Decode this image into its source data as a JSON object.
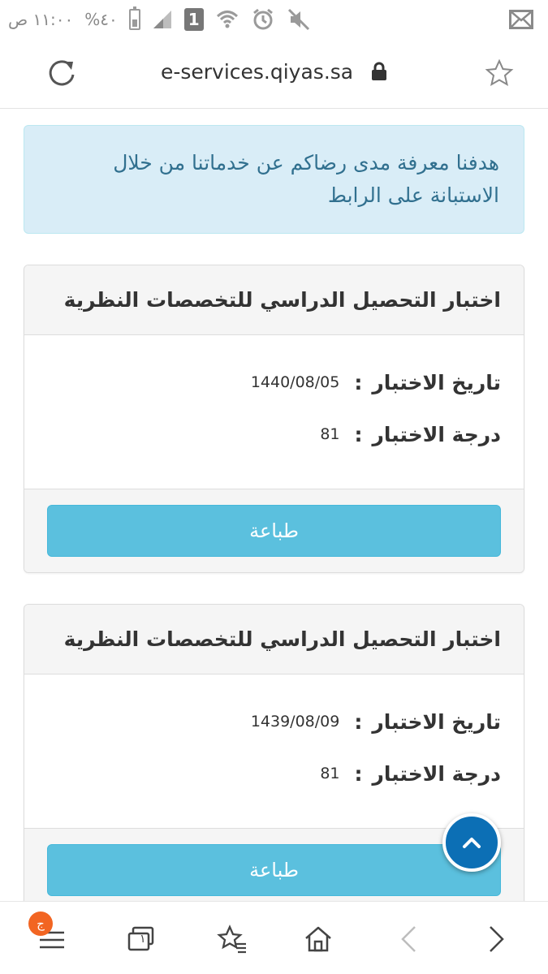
{
  "status_bar": {
    "time": "١١:٠٠ ص",
    "battery": "%٤٠",
    "sim_label": "1"
  },
  "browser": {
    "url": "e-services.qiyas.sa"
  },
  "alert": {
    "text": "هدفنا معرفة مدى رضاكم عن خدماتنا من خلال الاستبانة على الرابط"
  },
  "results": [
    {
      "title": "اختبار التحصيل الدراسي للتخصصات النظرية",
      "date_label": "تاريخ الاختبار",
      "date_value": "1440/08/05",
      "score_label": "درجة الاختبار",
      "score_value": "81",
      "print_label": "طباعة"
    },
    {
      "title": "اختبار التحصيل الدراسي للتخصصات النظرية",
      "date_label": "تاريخ الاختبار",
      "date_value": "1439/08/09",
      "score_label": "درجة الاختبار",
      "score_value": "81",
      "print_label": "طباعة"
    }
  ],
  "bottom_nav": {
    "menu_badge": "ج",
    "tab_count": "١"
  },
  "colors": {
    "alert_bg": "#d9edf7",
    "alert_text": "#31708f",
    "button_bg": "#5bc0de",
    "fab_bg": "#0c6fb5",
    "badge_bg": "#f26522"
  }
}
